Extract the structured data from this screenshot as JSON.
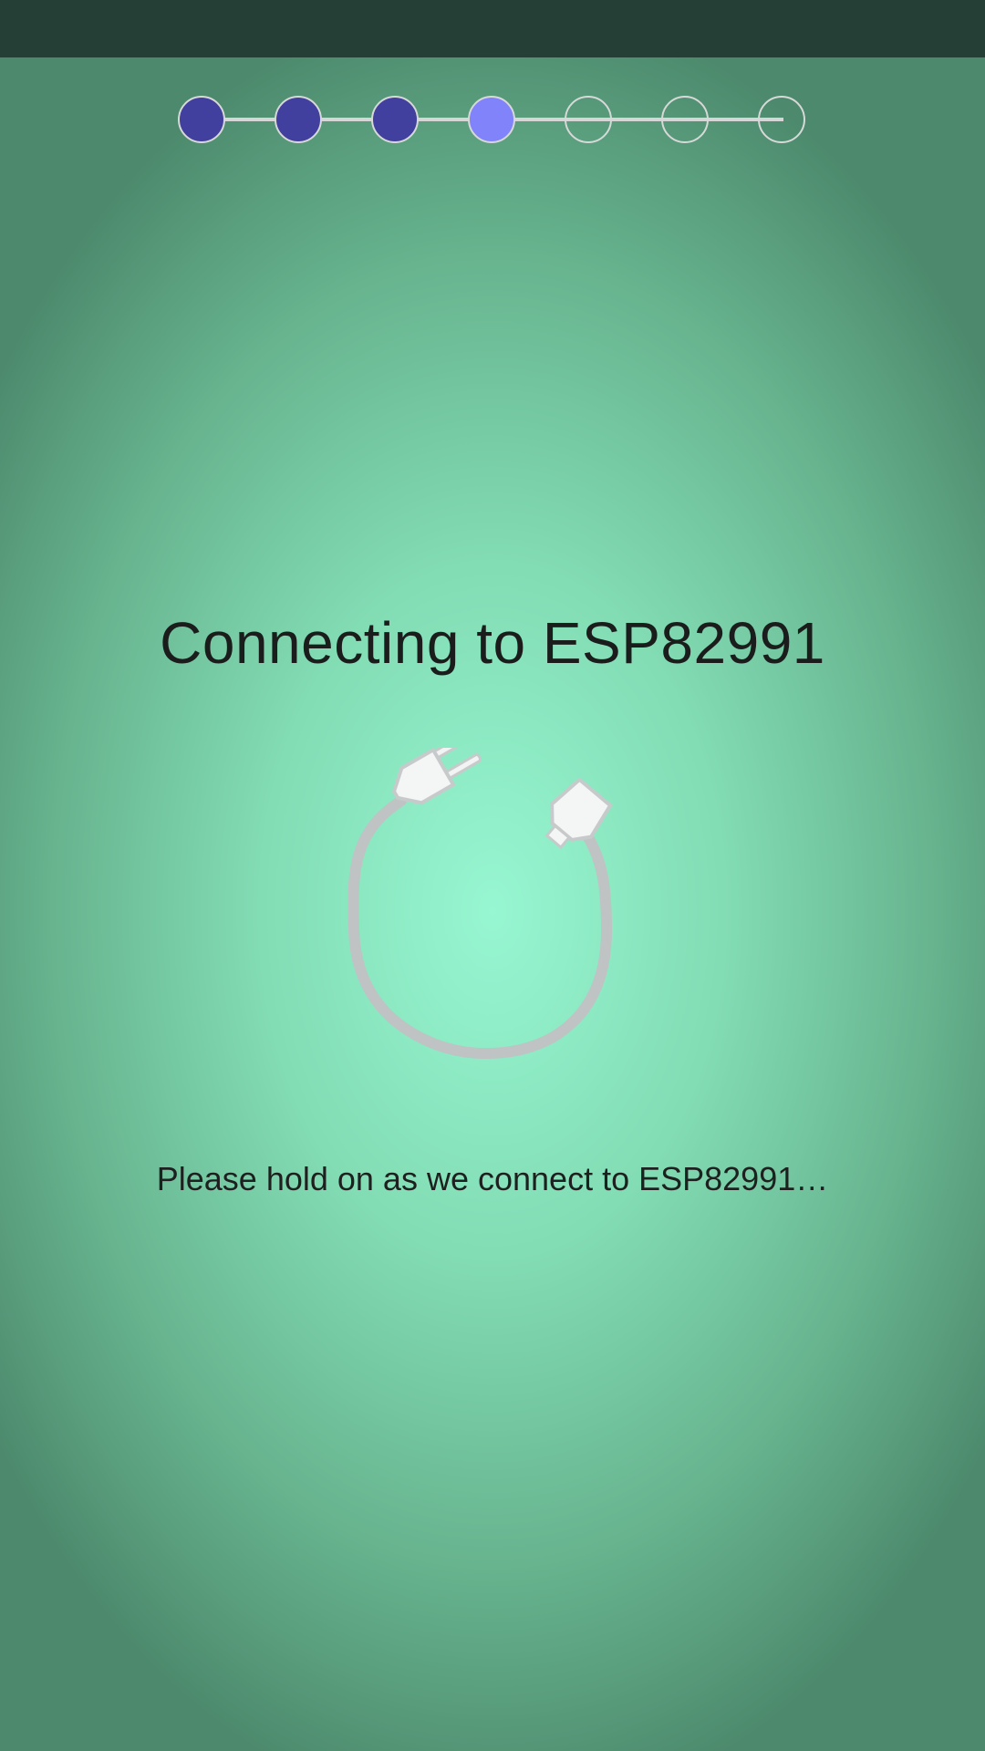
{
  "stepper": {
    "total_steps": 7,
    "completed_steps": 3,
    "current_step": 4,
    "colors": {
      "done": "#42409e",
      "current": "#8183fb",
      "pending_border": "#d7d9d8"
    }
  },
  "main": {
    "title": "Connecting to ESP82991",
    "message": "Please hold on as we connect to ESP82991…",
    "illustration_icon": "unplugged-cable-icon"
  },
  "colors": {
    "status_bar": "#253f36",
    "background_center": "#97f7d2",
    "background_edge": "#4d8a6d"
  }
}
